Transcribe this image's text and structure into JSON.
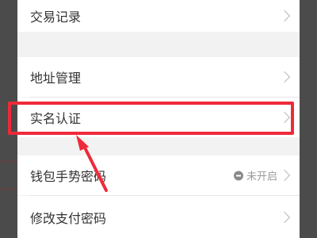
{
  "menu": {
    "items": [
      {
        "label": "交易记录"
      },
      {
        "label": "地址管理"
      },
      {
        "label": "实名认证"
      },
      {
        "label": "钱包手势密码",
        "status": "未开启"
      },
      {
        "label": "修改支付密码"
      }
    ]
  },
  "annotation": {
    "color": "#ee2a3a"
  }
}
